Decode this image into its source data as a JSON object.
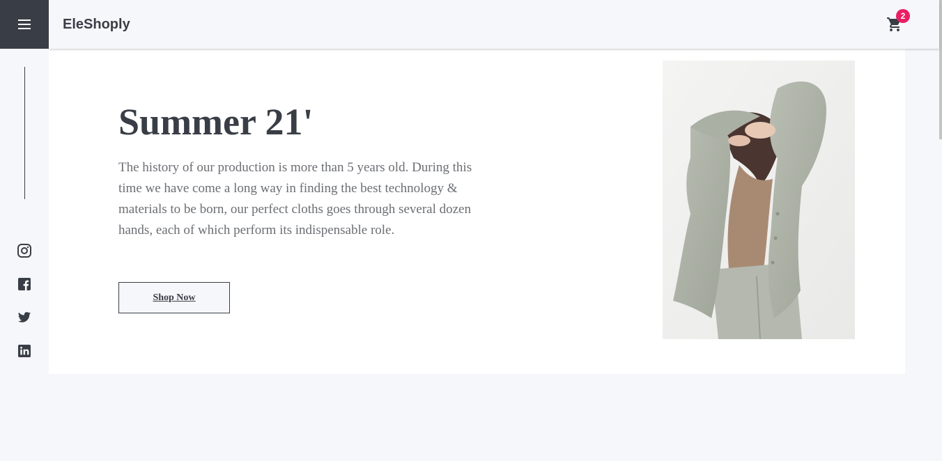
{
  "header": {
    "menu_icon": "hamburger-menu-icon",
    "brand": "EleShoply",
    "cart_icon": "shopping-cart-icon",
    "cart_count": "2",
    "badge_color": "#ea1e63",
    "menu_bg": "#393e46"
  },
  "sidebar": {
    "social_links": [
      {
        "icon": "instagram-icon"
      },
      {
        "icon": "facebook-icon"
      },
      {
        "icon": "twitter-icon"
      },
      {
        "icon": "linkedin-icon"
      }
    ]
  },
  "hero": {
    "title": "Summer 21'",
    "description": "The history of our production is more than 5 years old. During this time we have come a long way in finding the best technology & materials to be born, our perfect cloths goes through several dozen hands, each of which perform its indispensable role.",
    "cta_label": "Shop Now",
    "image_icon": "model-photo"
  }
}
